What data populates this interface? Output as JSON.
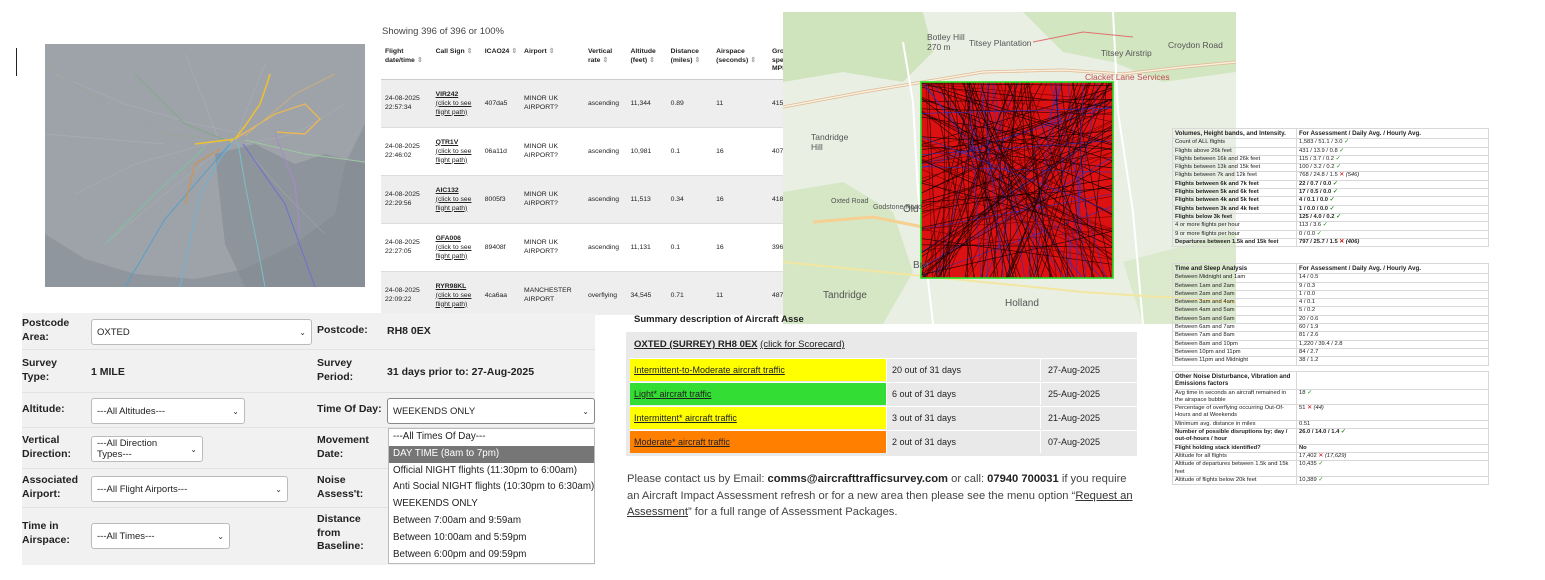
{
  "table": {
    "showing": "Showing 396 of 396 or 100%",
    "headers": [
      "Flight date/time",
      "Call Sign",
      "ICAO24",
      "Airport",
      "Vertical rate",
      "Altitude (feet)",
      "Distance (miles)",
      "Airspace (seconds)",
      "Ground speed MPH"
    ],
    "click_text": "(click to see flight path)",
    "rows": [
      {
        "date": "24-08-2025",
        "time": "22:57:34",
        "callsign": "VIR242",
        "icao": "407da5",
        "airport": "MINOR UK AIRPORT?",
        "vrate": "ascending",
        "alt": "11,344",
        "dist": "0.89",
        "airspace": "11",
        "speed": "415"
      },
      {
        "date": "24-08-2025",
        "time": "22:46:02",
        "callsign": "QTR1V",
        "icao": "06a11d",
        "airport": "MINOR UK AIRPORT?",
        "vrate": "ascending",
        "alt": "10,981",
        "dist": "0.1",
        "airspace": "16",
        "speed": "407"
      },
      {
        "date": "24-08-2025",
        "time": "22:29:56",
        "callsign": "AIC132",
        "icao": "8005f3",
        "airport": "MINOR UK AIRPORT?",
        "vrate": "ascending",
        "alt": "11,513",
        "dist": "0.34",
        "airspace": "16",
        "speed": "418"
      },
      {
        "date": "24-08-2025",
        "time": "22:27:05",
        "callsign": "GFA006",
        "icao": "89408f",
        "airport": "MINOR UK AIRPORT?",
        "vrate": "ascending",
        "alt": "11,131",
        "dist": "0.1",
        "airspace": "16",
        "speed": "396"
      },
      {
        "date": "24-08-2025",
        "time": "22:09:22",
        "callsign": "RYR98KL",
        "icao": "4ca6aa",
        "airport": "MANCHESTER AIRPORT",
        "vrate": "overflying",
        "alt": "34,545",
        "dist": "0.71",
        "airspace": "11",
        "speed": "487"
      }
    ]
  },
  "map2": {
    "labels": [
      "Botley Hill",
      "270 m",
      "Titsey Plantation",
      "Titsey Airstrip",
      "Croydon Road",
      "Clacket Lane Services",
      "Tandridge Hill",
      "Oxted Road",
      "Godstone Road",
      "Old",
      "Bro",
      "Tandridge",
      "Holland"
    ]
  },
  "form": {
    "postcode_area_label": "Postcode Area:",
    "postcode_area_value": "OXTED",
    "postcode_label": "Postcode:",
    "postcode_value": "RH8 0EX",
    "survey_type_label": "Survey Type:",
    "survey_type_value": "1 MILE",
    "survey_period_label": "Survey Period:",
    "survey_period_value": "31 days prior to: 27-Aug-2025",
    "altitude_label": "Altitude:",
    "altitude_value": "---All Altitudes---",
    "time_of_day_label": "Time Of Day:",
    "time_of_day_value": "WEEKENDS ONLY",
    "vertical_label": "Vertical Direction:",
    "vertical_value": "---All Direction Types---",
    "movement_label": "Movement Date:",
    "airport_label": "Associated Airport:",
    "airport_value": "---All Flight Airports---",
    "noise_label": "Noise Assess't:",
    "time_airspace_label": "Time in Airspace:",
    "time_airspace_value": "---All Times---",
    "distance_label": "Distance from Baseline:"
  },
  "dropdown": {
    "options": [
      "---All Times Of Day---",
      "DAY TIME (8am to 7pm)",
      "Official NIGHT flights (11:30pm to 6:00am)",
      "Anti Social NIGHT flights (10:30pm to 6:30am)",
      "WEEKENDS ONLY",
      "Between 7:00am and 9:59am",
      "Between 10:00am and 5:59pm",
      "Between 6:00pm and 09:59pm"
    ],
    "highlighted": "DAY TIME (8am to 7pm)"
  },
  "summary": {
    "title": "Summary description of Aircraft Asse",
    "area": "OXTED (SURREY) RH8 0EX",
    "scorecard": "(click for Scorecard)",
    "rows": [
      {
        "label": "Intermittent-to-Moderate aircraft traffic",
        "days": "20 out of 31 days",
        "date": "27-Aug-2025",
        "color": "#ffff00"
      },
      {
        "label": "Light* aircraft traffic",
        "days": "6 out of 31 days",
        "date": "25-Aug-2025",
        "color": "#33dd33"
      },
      {
        "label": "Intermittent* aircraft traffic",
        "days": "3 out of 31 days",
        "date": "21-Aug-2025",
        "color": "#ffff00"
      },
      {
        "label": "Moderate* aircraft traffic",
        "days": "2 out of 31 days",
        "date": "07-Aug-2025",
        "color": "#ff8000"
      }
    ]
  },
  "contact": {
    "t1": "Please contact us by Email: ",
    "email": "comms@aircrafttrafficsurvey.com",
    "t2": " or call: ",
    "phone": "07940 700031",
    "t3": " if you require an Aircraft Impact Assessment refresh or for a new area then please see the menu option “",
    "link": "Request an Assessment",
    "t4": "” for a full range of Assessment Packages."
  },
  "stats1": {
    "h1": "Volumes, Height bands, and Intensity.",
    "h2": "For Assessment / Daily Avg. / Hourly Avg.",
    "rows": [
      {
        "k": "Count of ALL flights",
        "v": "1,583 / 51.1 / 3.0",
        "m": "ok",
        "b": false
      },
      {
        "k": "Flights above 26k feet",
        "v": "431 / 13.9 / 0.8",
        "m": "ok",
        "b": false
      },
      {
        "k": "Flights between 16k and 26k feet",
        "v": "115 / 3.7 / 0.2",
        "m": "ok",
        "b": false
      },
      {
        "k": "Flights between 13k and 15k feet",
        "v": "100 / 3.2 / 0.2",
        "m": "ok",
        "b": false
      },
      {
        "k": "Flights between 7k and 12k feet",
        "v": "768 / 24.8 / 1.5",
        "m": "x",
        "extra": "(546)",
        "b": false
      },
      {
        "k": "Flights between 6k and 7k feet",
        "v": "22 / 0.7 / 0.0",
        "m": "ok",
        "b": true
      },
      {
        "k": "Flights between 5k and 6k feet",
        "v": "17 / 0.5 / 0.0",
        "m": "ok",
        "b": true
      },
      {
        "k": "Flights between 4k and 5k feet",
        "v": "4 / 0.1 / 0.0",
        "m": "ok",
        "b": true
      },
      {
        "k": "Flights between 3k and 4k feet",
        "v": "1 / 0.0 / 0.0",
        "m": "ok",
        "b": true
      },
      {
        "k": "Flights below 3k feet",
        "v": "125 / 4.0 / 0.2",
        "m": "ok",
        "b": true
      },
      {
        "k": "4 or more flights per hour",
        "v": "113 / 3.6",
        "m": "ok",
        "b": false
      },
      {
        "k": "9 or more flights per hour",
        "v": "0 / 0.0",
        "m": "ok",
        "b": false
      },
      {
        "k": "Departures between 1.5k and 15k feet",
        "v": "797 / 25.7 / 1.5",
        "m": "x",
        "extra": "(406)",
        "b": true
      }
    ]
  },
  "stats2": {
    "h1": "Time and Sleep Analysis",
    "h2": "For Assessment / Daily Avg. / Hourly Avg.",
    "rows": [
      {
        "k": "Between Midnight and 1am",
        "v": "14 / 0.5"
      },
      {
        "k": "Between 1am and 2am",
        "v": "9 / 0.3"
      },
      {
        "k": "Between 2am and 3am",
        "v": "1 / 0.0"
      },
      {
        "k": "Between 3am and 4am",
        "v": "4 / 0.1"
      },
      {
        "k": "Between 4am and 5am",
        "v": "5 / 0.2"
      },
      {
        "k": "Between 5am and 6am",
        "v": "20 / 0.6"
      },
      {
        "k": "Between 6am and 7am",
        "v": "60 / 1.9"
      },
      {
        "k": "Between 7am and 8am",
        "v": "81 / 2.6"
      },
      {
        "k": "Between 8am and 10pm",
        "v": "1,220 / 39.4 / 2.8"
      },
      {
        "k": "Between 10pm and 11pm",
        "v": "84 / 2.7"
      },
      {
        "k": "Between 11pm and Midnight",
        "v": "38 / 1.2"
      }
    ]
  },
  "stats3": {
    "h1": "Other Noise Disturbance, Vibration and Emissions factors",
    "rows": [
      {
        "k": "Avg time in seconds an aircraft remained in the airspace bubble",
        "v": "18",
        "m": "ok",
        "b": false
      },
      {
        "k": "Percentage of overflying occurring Out-Of-Hours and at Weekends",
        "v": "51",
        "m": "x",
        "extra": "(44)",
        "b": false
      },
      {
        "k": "Minimum avg. distance in miles",
        "v": "0.51",
        "m": "",
        "b": false
      },
      {
        "k": "Number of possible disruptions by; day / out-of-hours / hour",
        "v": "26.0 / 14.0 / 1.4",
        "m": "ok",
        "b": true
      },
      {
        "k": "Flight holding stack identified?",
        "v": "No",
        "m": "",
        "b": true
      },
      {
        "k": "Altitude for all flights",
        "v": "17,402",
        "m": "x",
        "extra": "(17,629)",
        "b": false
      },
      {
        "k": "Altitude of departures between 1.5k and 15k feet",
        "v": "10,435",
        "m": "ok",
        "b": false
      },
      {
        "k": "Altitude of flights below 20k feet",
        "v": "10,389",
        "m": "ok",
        "b": false
      }
    ]
  }
}
